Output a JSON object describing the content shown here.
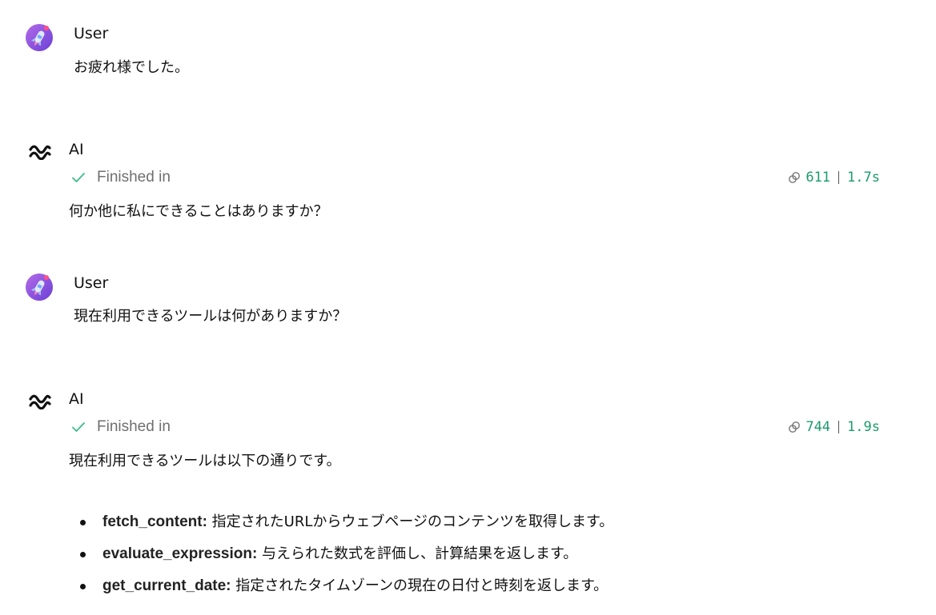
{
  "messages": [
    {
      "role": "user",
      "name": "User",
      "text": "お疲れ様でした。"
    },
    {
      "role": "ai",
      "name": "AI",
      "status": "Finished in",
      "tokens": "611",
      "time": "1.7s",
      "text": "何か他に私にできることはありますか？"
    },
    {
      "role": "user",
      "name": "User",
      "text": "現在利用できるツールは何がありますか？"
    },
    {
      "role": "ai",
      "name": "AI",
      "status": "Finished in",
      "tokens": "744",
      "time": "1.9s",
      "text": "現在利用できるツールは以下の通りです。",
      "tools": [
        {
          "name": "fetch_content:",
          "desc": "指定されたURLからウェブページのコンテンツを取得します。"
        },
        {
          "name": "evaluate_expression:",
          "desc": "与えられた数式を評価し、計算結果を返します。"
        },
        {
          "name": "get_current_date:",
          "desc": "指定されたタイムゾーンの現在の日付と時刻を返します。"
        }
      ]
    }
  ],
  "icons": {
    "user_avatar": "rocket-avatar-icon",
    "ai_logo": "langchain-logo-icon",
    "status": "check-icon",
    "tokens": "token-chain-icon"
  },
  "colors": {
    "accent_green": "#1d9b6c",
    "check_green": "#3dbb8a",
    "status_gray": "#6f6f6f",
    "avatar_purple": "#8e54e9"
  }
}
